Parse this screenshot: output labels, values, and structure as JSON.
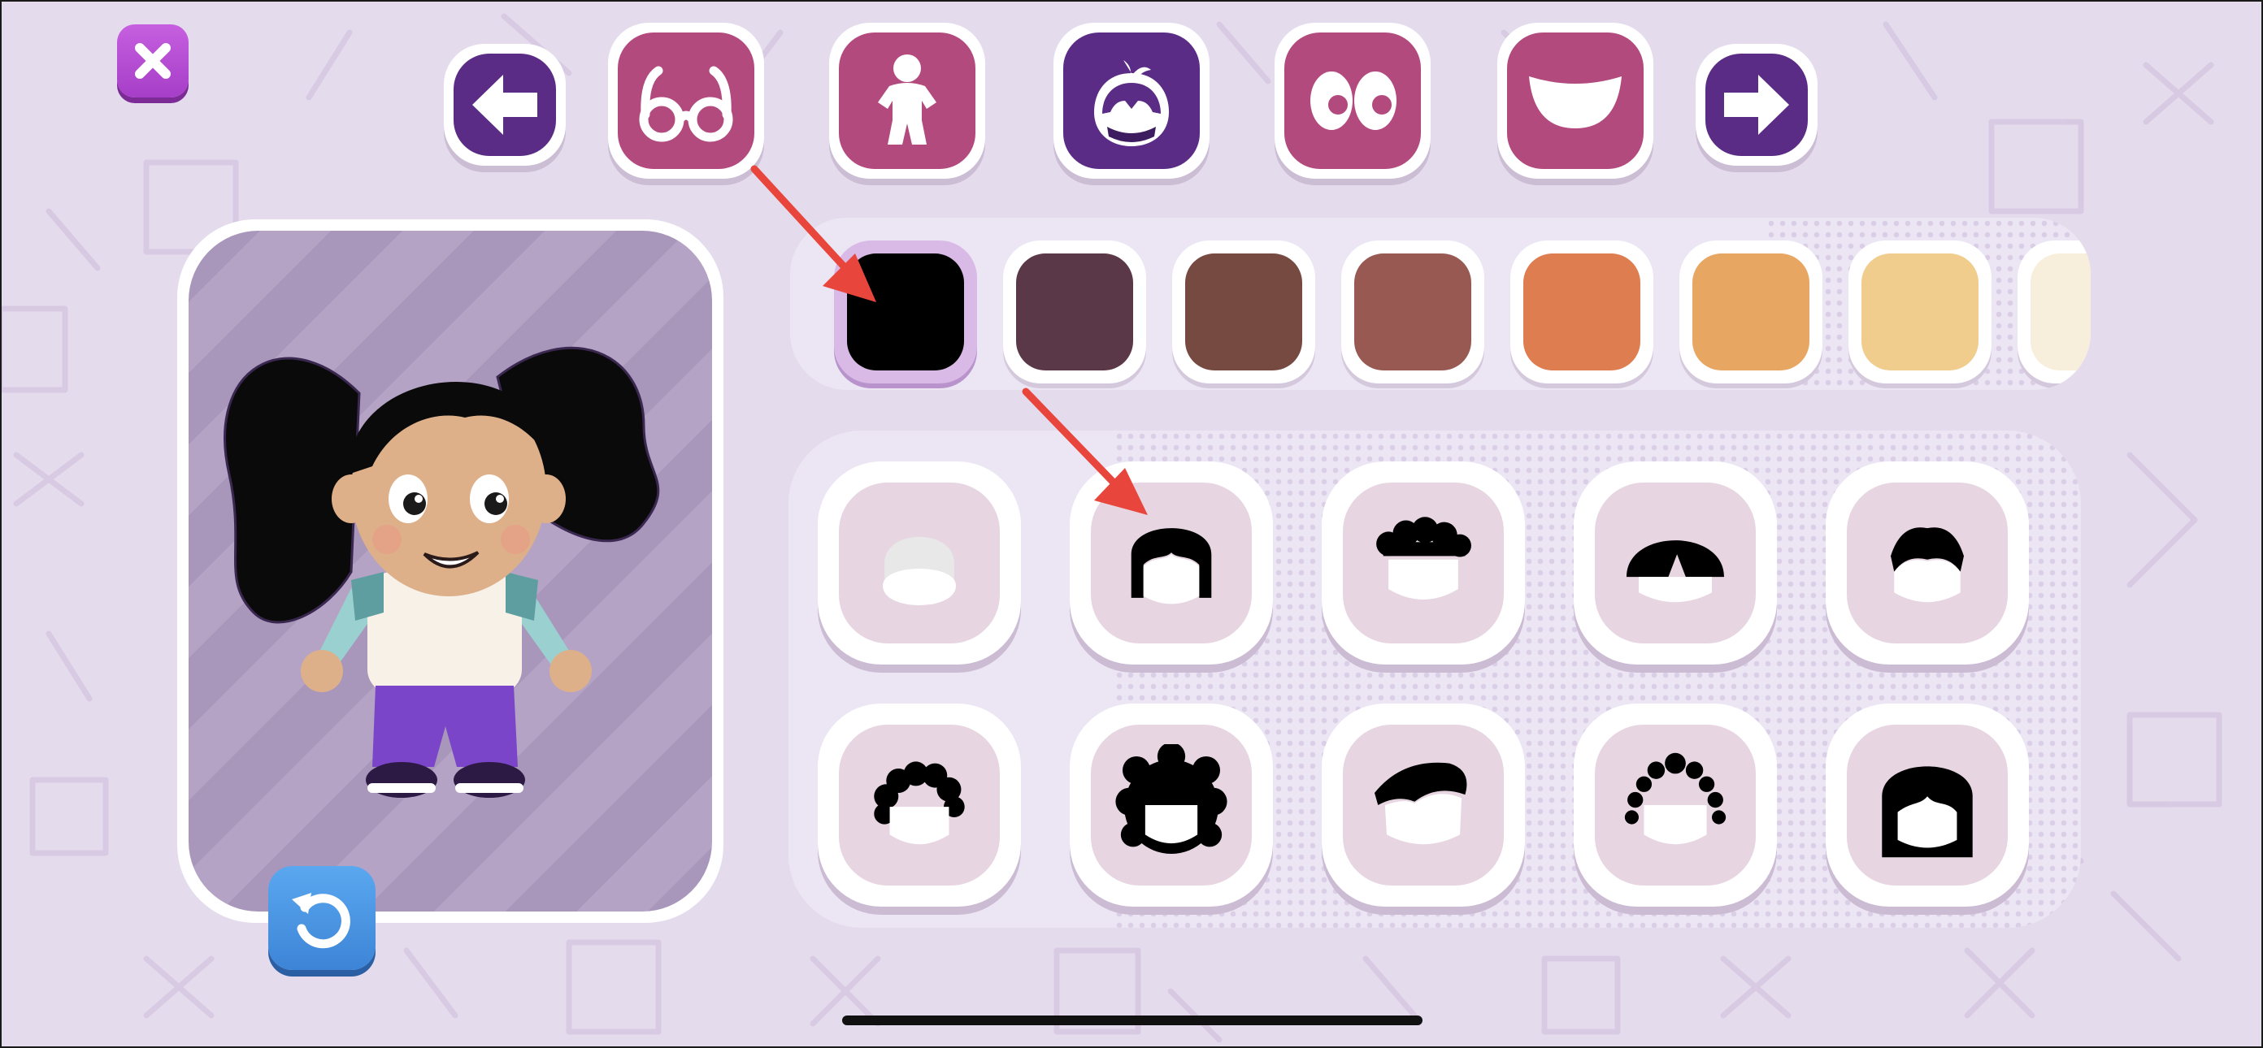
{
  "app": {
    "screen": "character-hair-editor"
  },
  "toolbar": {
    "close": {
      "icon": "close-icon",
      "color": "#b44fd6"
    },
    "prev": {
      "icon": "arrow-left-icon"
    },
    "next": {
      "icon": "arrow-right-icon"
    },
    "categories": [
      {
        "id": "glasses",
        "icon": "glasses-icon",
        "selected": false
      },
      {
        "id": "body",
        "icon": "body-figure-icon",
        "selected": false
      },
      {
        "id": "hair",
        "icon": "hair-head-icon",
        "selected": true
      },
      {
        "id": "eyes",
        "icon": "eyes-icon",
        "selected": false
      },
      {
        "id": "mouth",
        "icon": "mouth-smile-icon",
        "selected": false
      }
    ]
  },
  "preview": {
    "character": "girl-with-black-pigtails",
    "reset": {
      "icon": "reset-rotate-icon",
      "color": "#4a93e2"
    }
  },
  "hair_colors": {
    "selected_index": 0,
    "swatches": [
      "#000000",
      "#5b3847",
      "#764a41",
      "#975951",
      "#dd7d50",
      "#e7a662",
      "#f0cc8d",
      "#f7efdc"
    ]
  },
  "hair_styles": {
    "selected_index": 1,
    "styles": [
      "none-bald",
      "bob-with-bangs",
      "curly-top",
      "straight-center-part",
      "short-swept",
      "short-curly",
      "afro",
      "side-swept",
      "puff-curls",
      "long-straight-bangs"
    ]
  },
  "annotations": {
    "arrow_color": "#e8463c",
    "targets": [
      "selected-hair-color",
      "selected-hair-style"
    ]
  }
}
